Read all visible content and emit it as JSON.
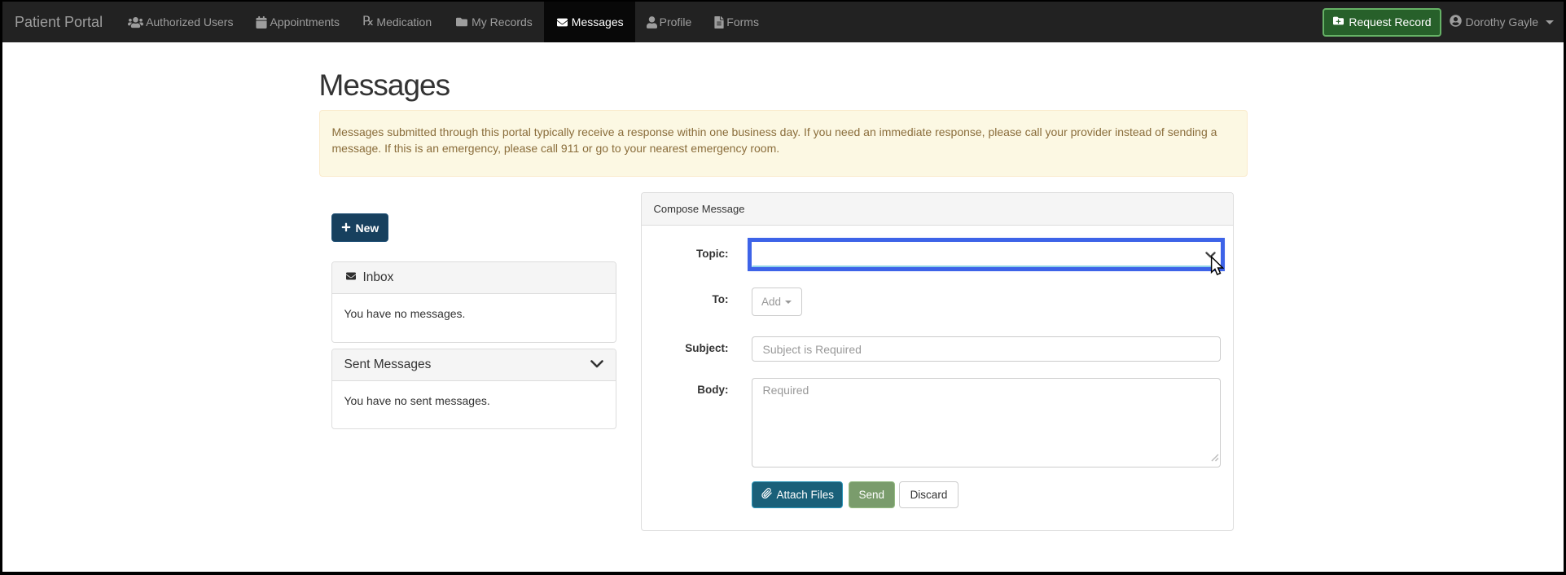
{
  "navbar": {
    "brand": "Patient Portal",
    "items": [
      {
        "label": "Authorized Users",
        "icon": "users"
      },
      {
        "label": "Appointments",
        "icon": "calendar"
      },
      {
        "label": "Medication",
        "icon": "rx"
      },
      {
        "label": "My Records",
        "icon": "folder"
      },
      {
        "label": "Messages",
        "icon": "envelope",
        "active": true
      },
      {
        "label": "Profile",
        "icon": "user"
      },
      {
        "label": "Forms",
        "icon": "file"
      }
    ],
    "request_record_label": "Request Record",
    "user_name": "Dorothy Gayle"
  },
  "page": {
    "title": "Messages"
  },
  "alert": {
    "text": "Messages submitted through this portal typically receive a response within one business day. If you need an immediate response, please call your provider instead of sending a message. If this is an emergency, please call 911 or go to your nearest emergency room."
  },
  "sidebar": {
    "new_button_label": "New",
    "inbox": {
      "title": "Inbox",
      "empty_text": "You have no messages."
    },
    "sent": {
      "title": "Sent Messages",
      "empty_text": "You have no sent messages."
    }
  },
  "compose": {
    "title": "Compose Message",
    "topic_label": "Topic:",
    "topic_value": "",
    "to_label": "To:",
    "add_button_label": "Add",
    "subject_label": "Subject:",
    "subject_placeholder": "Subject is Required",
    "subject_value": "",
    "body_label": "Body:",
    "body_placeholder": "Required",
    "body_value": "",
    "attach_button_label": "Attach Files",
    "send_button_label": "Send",
    "discard_button_label": "Discard"
  },
  "colors": {
    "navbar_bg": "#222222",
    "navbar_active_bg": "#080808",
    "navbar_link": "#9d9d9d",
    "request_button_green": "#27602a",
    "new_button_navy": "#17405e",
    "attach_button_teal": "#1a6079",
    "send_button_green": "#7a9c6c",
    "alert_bg": "#fcf8e3",
    "alert_text": "#8a6d3b",
    "focus_ring_blue": "#3d63e8"
  }
}
